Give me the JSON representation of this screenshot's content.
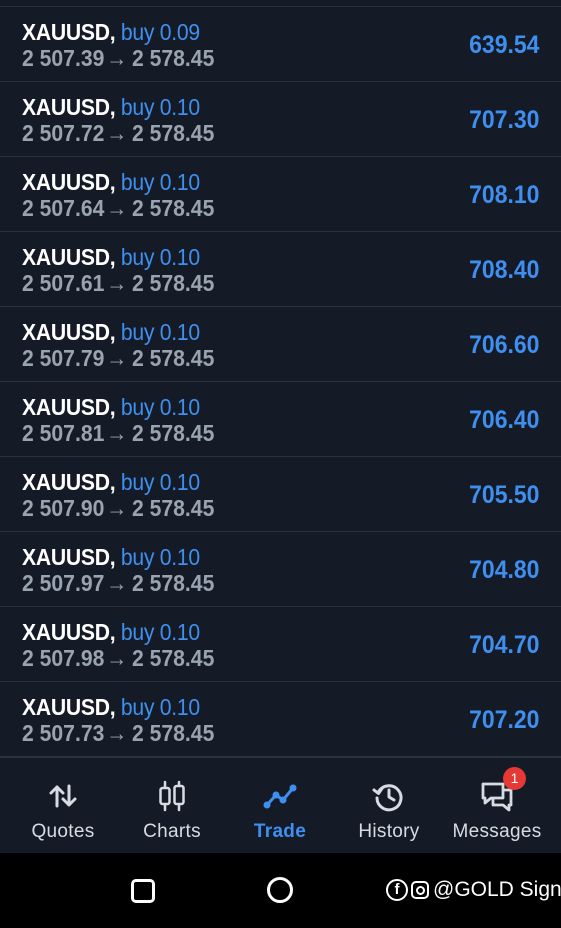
{
  "positions": [
    {
      "symbol": "XAUUSD,",
      "side": "buy 0.09",
      "open_price": "2 507.39",
      "arrow": "→",
      "current_price": "2 578.45",
      "profit": "639.54"
    },
    {
      "symbol": "XAUUSD,",
      "side": "buy 0.10",
      "open_price": "2 507.72",
      "arrow": "→",
      "current_price": "2 578.45",
      "profit": "707.30"
    },
    {
      "symbol": "XAUUSD,",
      "side": "buy 0.10",
      "open_price": "2 507.64",
      "arrow": "→",
      "current_price": "2 578.45",
      "profit": "708.10"
    },
    {
      "symbol": "XAUUSD,",
      "side": "buy 0.10",
      "open_price": "2 507.61",
      "arrow": "→",
      "current_price": "2 578.45",
      "profit": "708.40"
    },
    {
      "symbol": "XAUUSD,",
      "side": "buy 0.10",
      "open_price": "2 507.79",
      "arrow": "→",
      "current_price": "2 578.45",
      "profit": "706.60"
    },
    {
      "symbol": "XAUUSD,",
      "side": "buy 0.10",
      "open_price": "2 507.81",
      "arrow": "→",
      "current_price": "2 578.45",
      "profit": "706.40"
    },
    {
      "symbol": "XAUUSD,",
      "side": "buy 0.10",
      "open_price": "2 507.90",
      "arrow": "→",
      "current_price": "2 578.45",
      "profit": "705.50"
    },
    {
      "symbol": "XAUUSD,",
      "side": "buy 0.10",
      "open_price": "2 507.97",
      "arrow": "→",
      "current_price": "2 578.45",
      "profit": "704.80"
    },
    {
      "symbol": "XAUUSD,",
      "side": "buy 0.10",
      "open_price": "2 507.98",
      "arrow": "→",
      "current_price": "2 578.45",
      "profit": "704.70"
    },
    {
      "symbol": "XAUUSD,",
      "side": "buy 0.10",
      "open_price": "2 507.73",
      "arrow": "→",
      "current_price": "2 578.45",
      "profit": "707.20"
    }
  ],
  "tabbar": {
    "tabs": [
      {
        "label": "Quotes",
        "icon": "quotes-arrows-icon",
        "active": false
      },
      {
        "label": "Charts",
        "icon": "candlestick-icon",
        "active": false
      },
      {
        "label": "Trade",
        "icon": "trade-line-icon",
        "active": true
      },
      {
        "label": "History",
        "icon": "history-clock-icon",
        "active": false
      },
      {
        "label": "Messages",
        "icon": "messages-icon",
        "active": false,
        "badge": "1"
      }
    ]
  },
  "navbar": {
    "watermark": "@GOLD Signals"
  },
  "colors": {
    "background": "#141b26",
    "accent_blue": "#3f8ff0",
    "secondary_text": "#9aa3b0",
    "divider": "#2a3240",
    "badge_red": "#e53935"
  }
}
